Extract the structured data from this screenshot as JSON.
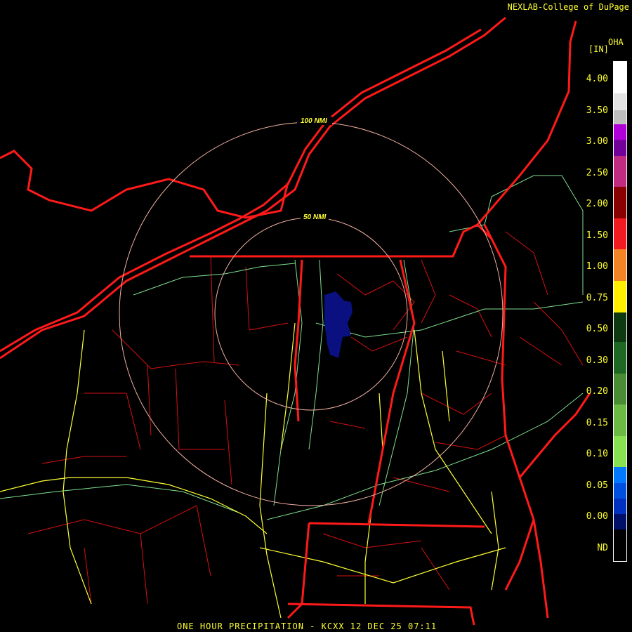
{
  "header": {
    "credit": "NEXLAB-College of DuPage",
    "credit_icon": "logo-mark-icon"
  },
  "legend": {
    "unit": "[IN]",
    "product_code": "OHA",
    "labels": [
      "4.00",
      "3.50",
      "3.00",
      "2.50",
      "2.00",
      "1.50",
      "1.00",
      "0.75",
      "0.50",
      "0.30",
      "0.20",
      "0.15",
      "0.10",
      "0.05",
      "0.00",
      "ND"
    ],
    "colors": [
      "#ffffff",
      "#e4e4e4",
      "#bebebe",
      "#b000d8",
      "#72009a",
      "#c02a80",
      "#880000",
      "#f01a20",
      "#f28426",
      "#fff000",
      "#0e3a12",
      "#1f6824",
      "#4a8c34",
      "#6cba44",
      "#88e250",
      "#0078ff",
      "#0050e0",
      "#0030c0",
      "#001068",
      "#000000"
    ],
    "segment_weights": [
      2,
      1.1,
      0.9,
      1,
      1,
      2,
      2,
      2,
      2,
      2,
      1.9,
      2,
      2,
      2,
      2,
      1,
      1,
      1,
      1,
      2
    ]
  },
  "map": {
    "range_rings": [
      "100 NMI",
      "50 NMI"
    ],
    "colors": {
      "state_border": "#ff1a1a",
      "county_border": "#e01010",
      "river": "#7fe08f",
      "highway": "#ffff33",
      "ring": "#f0b0a0",
      "precip": "#0a1080"
    }
  },
  "footer": {
    "title": "ONE HOUR PRECIPITATION - KCXX 12 DEC 25 07:11"
  }
}
